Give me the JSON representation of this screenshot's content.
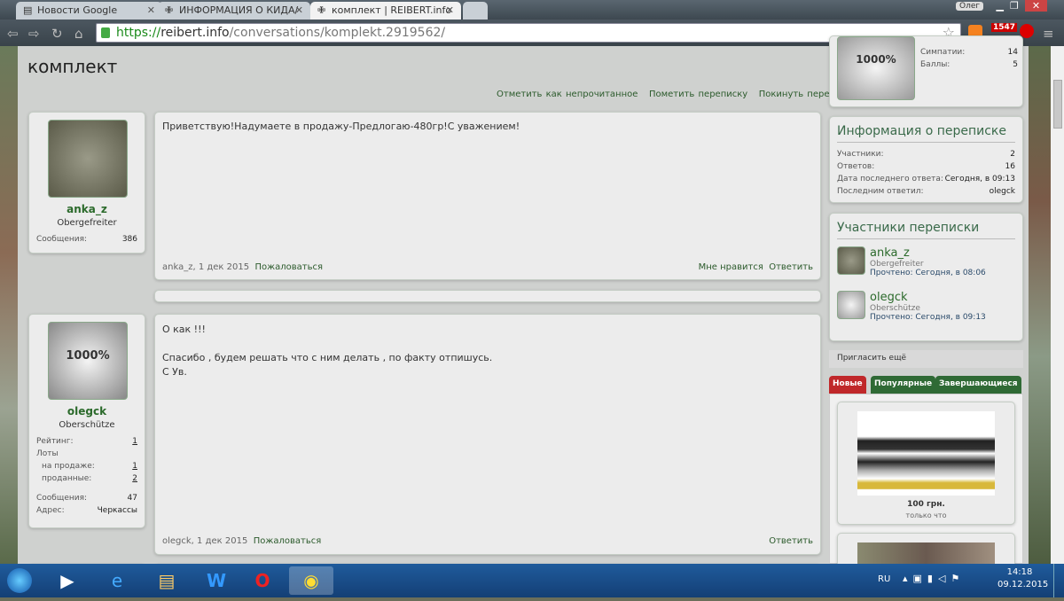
{
  "browser": {
    "tabs": [
      {
        "label": "Новости Google"
      },
      {
        "label": "ИНФОРМАЦИЯ О КИДА/"
      },
      {
        "label": "комплект | REIBERT.info"
      }
    ],
    "url_scheme": "https://",
    "url_host": "reibert.info",
    "url_path": "/conversations/komplekt.2919562/",
    "user_badge": "Олег",
    "ext_badge": "1547"
  },
  "page": {
    "title": "комплект",
    "actions": [
      "Отметить как непрочитанное",
      "Пометить переписку",
      "Покинуть переписку"
    ]
  },
  "posts": [
    {
      "user": "anka_z",
      "rank": "Obergefreiter",
      "stats": [
        {
          "k": "Сообщения:",
          "v": "386"
        }
      ],
      "lines": [
        "Приветствую!Надумаете в продажу-Предлогаю-480гр!С уважением!"
      ],
      "meta": "anka_z, 1 дек 2015",
      "report": "Пожаловаться",
      "like": "Мне нравится",
      "reply": "Ответить"
    },
    {
      "user": "olegck",
      "rank": "Oberschütze",
      "rating_k": "Рейтинг:",
      "rating_v": "1",
      "lots": "Лоты",
      "sale_k": "на продаже:",
      "sale_v": "1",
      "sold_k": "проданные:",
      "sold_v": "2",
      "msgs_k": "Сообщения:",
      "msgs_v": "47",
      "addr_k": "Адрес:",
      "addr_v": "Черкассы",
      "lines": [
        "О как !!!",
        "",
        "Спасибо , будем решать что с ним делать , по факту отпишусь.",
        "С Ув."
      ],
      "meta": "olegck, 1 дек 2015",
      "report": "Пожаловаться",
      "reply": "Ответить"
    }
  ],
  "sidebar": {
    "profile": {
      "likes_k": "Симпатии:",
      "likes_v": "14",
      "points_k": "Баллы:",
      "points_v": "5"
    },
    "info": {
      "title": "Информация о переписке",
      "rows": [
        {
          "k": "Участники:",
          "v": "2"
        },
        {
          "k": "Ответов:",
          "v": "16"
        },
        {
          "k": "Дата последнего ответа:",
          "v": "Сегодня, в 09:13"
        },
        {
          "k": "Последним ответил:",
          "v": "olegck"
        }
      ]
    },
    "participants": {
      "title": "Участники переписки",
      "items": [
        {
          "name": "anka_z",
          "rank": "Obergefreiter",
          "read": "Прочтено: Сегодня, в 08:06"
        },
        {
          "name": "olegck",
          "rank": "Oberschütze",
          "read": "Прочтено: Сегодня, в 09:13"
        }
      ]
    },
    "invite": "Пригласить ещё",
    "lot_tabs": [
      "Новые",
      "Популярные",
      "Завершающиеся"
    ],
    "lot": {
      "price": "100 грн.",
      "time": "только что"
    }
  },
  "taskbar": {
    "lang": "RU",
    "time": "14:18",
    "date": "09.12.2015"
  },
  "colors": {
    "tab_new": "#c0282a",
    "tab_other": "#2f6a35"
  }
}
